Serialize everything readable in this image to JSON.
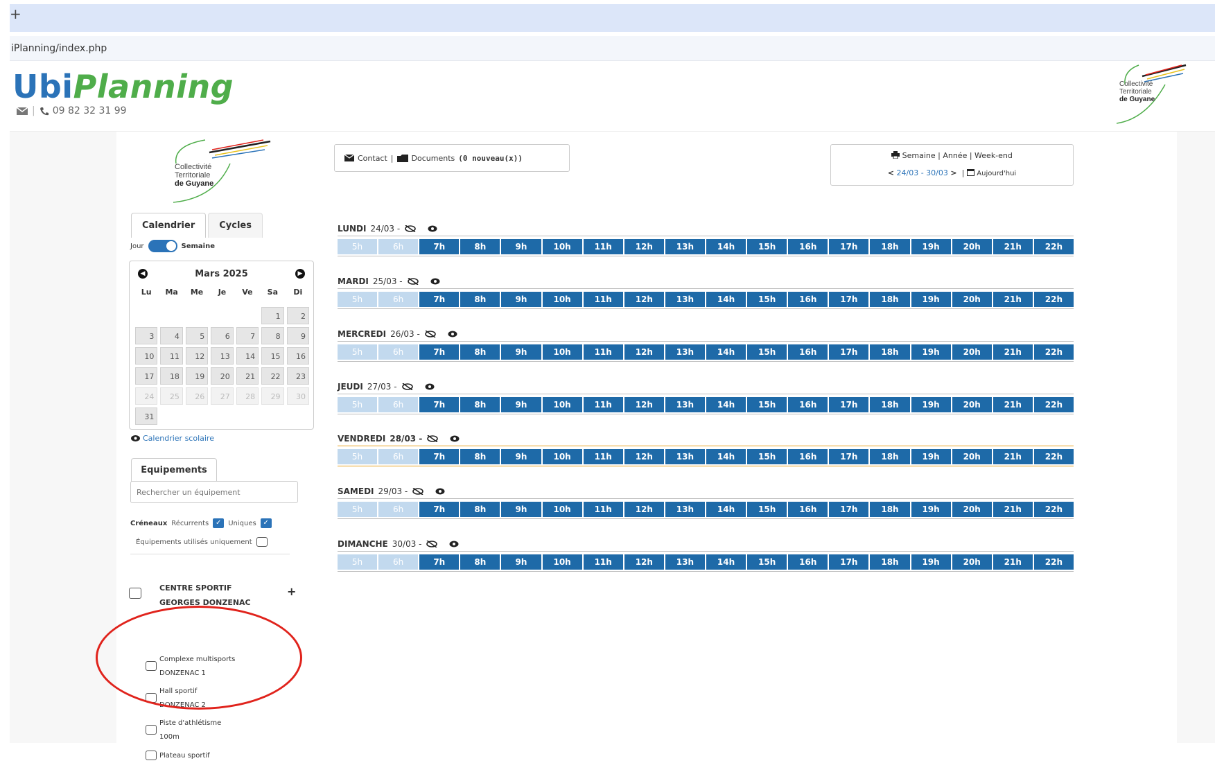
{
  "browser": {
    "new_tab": "+",
    "url": "iPlanning/index.php"
  },
  "header": {
    "logo_ubi": "Ubi",
    "logo_planning": "Planning",
    "phone": "09 82 32 31 99",
    "partner_logo_line1": "Collectivité",
    "partner_logo_line2": "Territoriale",
    "partner_logo_line3": "de Guyane"
  },
  "sidebar": {
    "tabs": [
      "Calendrier",
      "Cycles"
    ],
    "toggle_left": "Jour",
    "toggle_right": "Semaine",
    "calendar": {
      "month": "Mars 2025",
      "weekdays": [
        "Lu",
        "Ma",
        "Me",
        "Je",
        "Ve",
        "Sa",
        "Di"
      ],
      "days": [
        "",
        "",
        "",
        "",
        "",
        "1",
        "2",
        "3",
        "4",
        "5",
        "6",
        "7",
        "8",
        "9",
        "10",
        "11",
        "12",
        "13",
        "14",
        "15",
        "16",
        "17",
        "18",
        "19",
        "20",
        "21",
        "22",
        "23",
        "24",
        "25",
        "26",
        "27",
        "28",
        "29",
        "30",
        "31"
      ]
    },
    "school_calendar": "Calendrier scolaire",
    "equipements_tab": "Equipements",
    "search_placeholder": "Rechercher un équipement",
    "creneaux_label": "Créneaux",
    "recurrents_label": "Récurrents",
    "uniques_label": "Uniques",
    "used_only_label": "Équipements utilisés uniquement",
    "centre_line1": "CENTRE SPORTIF",
    "centre_line2": "GEORGES DONZENAC",
    "expand": "+",
    "equipments": [
      {
        "line1": "Complexe multisports",
        "line2": "DONZENAC 1"
      },
      {
        "line1": "Hall sportif",
        "line2": "DONZENAC 2"
      },
      {
        "line1": "Piste d'athlétisme",
        "line2": "100m"
      },
      {
        "line1": "Plateau sportif",
        "line2": ""
      }
    ]
  },
  "toolbar": {
    "contact": "Contact",
    "documents": "Documents",
    "documents_count": "(0 nouveau(x))",
    "view_semaine": "Semaine",
    "view_annee": "Année",
    "view_weekend": "Week-end",
    "range": "24/03 - 30/03",
    "today": "Aujourd'hui"
  },
  "days": [
    {
      "name": "LUNDI",
      "date": "24/03 -",
      "today": false
    },
    {
      "name": "MARDI",
      "date": "25/03 -",
      "today": false
    },
    {
      "name": "MERCREDI",
      "date": "26/03 -",
      "today": false
    },
    {
      "name": "JEUDI",
      "date": "27/03 -",
      "today": false
    },
    {
      "name": "VENDREDI",
      "date": "28/03 -",
      "today": true
    },
    {
      "name": "SAMEDI",
      "date": "29/03 -",
      "today": false
    },
    {
      "name": "DIMANCHE",
      "date": "30/03 -",
      "today": false
    }
  ],
  "hours": [
    "5h",
    "6h",
    "7h",
    "8h",
    "9h",
    "10h",
    "11h",
    "12h",
    "13h",
    "14h",
    "15h",
    "16h",
    "17h",
    "18h",
    "19h",
    "20h",
    "21h",
    "22h"
  ],
  "inactive_hours": [
    "5h",
    "6h"
  ],
  "colors": {
    "brand_blue": "#2b73b8",
    "brand_green": "#4fad4a",
    "hour_active": "#1e6aa8",
    "hour_inactive": "#c2d9ee",
    "today_line": "#e8a21f",
    "highlight": "#e0231c"
  }
}
